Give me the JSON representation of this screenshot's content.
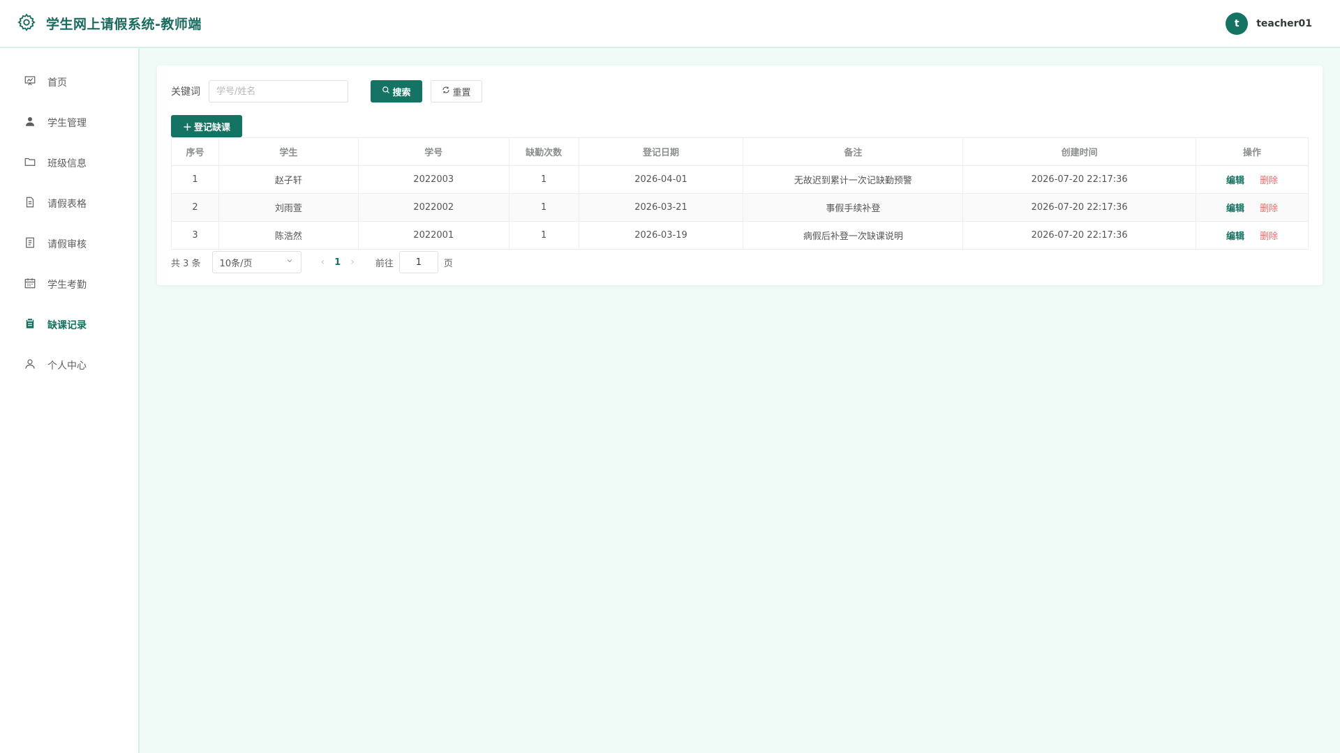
{
  "app": {
    "title": "学生网上请假系统-教师端"
  },
  "user": {
    "avatar_letter": "t",
    "name": "teacher01"
  },
  "sidebar": {
    "items": [
      {
        "label": "首页",
        "icon": "presentation-icon"
      },
      {
        "label": "学生管理",
        "icon": "user-icon"
      },
      {
        "label": "班级信息",
        "icon": "folder-icon"
      },
      {
        "label": "请假表格",
        "icon": "document-icon"
      },
      {
        "label": "请假审核",
        "icon": "tickets-icon"
      },
      {
        "label": "学生考勤",
        "icon": "calendar-icon"
      },
      {
        "label": "缺课记录",
        "icon": "clipboard-icon",
        "active": true
      },
      {
        "label": "个人中心",
        "icon": "user-outline-icon"
      }
    ]
  },
  "search": {
    "label": "关键词",
    "placeholder": "学号/姓名",
    "value": "",
    "search_button": "搜索",
    "reset_button": "重置"
  },
  "toolbar": {
    "add_button": "登记缺课"
  },
  "table": {
    "columns": [
      "序号",
      "学生",
      "学号",
      "缺勤次数",
      "登记日期",
      "备注",
      "创建时间",
      "操作"
    ],
    "rows": [
      {
        "index": "1",
        "student": "赵子轩",
        "student_id": "2022003",
        "count": "1",
        "date": "2026-04-01",
        "note": "无故迟到累计一次记缺勤预警",
        "created": "2026-07-20 22:17:36"
      },
      {
        "index": "2",
        "student": "刘雨萱",
        "student_id": "2022002",
        "count": "1",
        "date": "2026-03-21",
        "note": "事假手续补登",
        "created": "2026-07-20 22:17:36"
      },
      {
        "index": "3",
        "student": "陈浩然",
        "student_id": "2022001",
        "count": "1",
        "date": "2026-03-19",
        "note": "病假后补登一次缺课说明",
        "created": "2026-07-20 22:17:36"
      }
    ],
    "edit_label": "编辑",
    "delete_label": "删除"
  },
  "pagination": {
    "total_text": "共 3 条",
    "page_size": "10条/页",
    "current_page": "1",
    "goto_label": "前往",
    "goto_value": "1",
    "page_suffix": "页"
  },
  "colors": {
    "primary": "#157364",
    "danger": "#f06b6b",
    "background": "#f0fbf8"
  }
}
